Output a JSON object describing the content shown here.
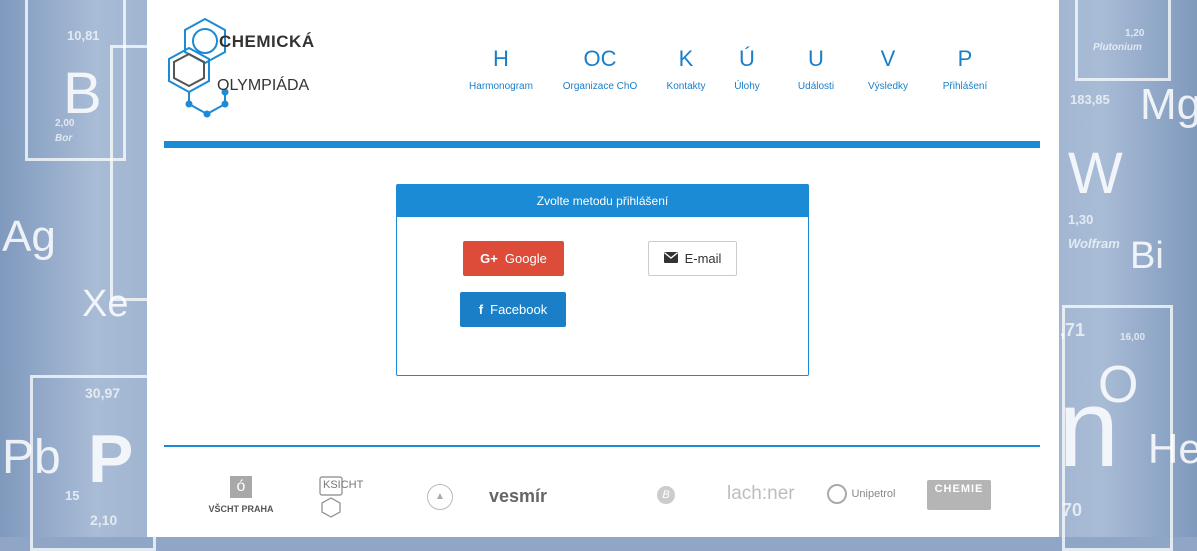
{
  "brand": {
    "line1": "CHEMICKÁ",
    "line2": "OLYMPIÁDA"
  },
  "nav": [
    {
      "letter": "H",
      "label": "Harmonogram"
    },
    {
      "letter": "OC",
      "label": "Organizace ChO"
    },
    {
      "letter": "K",
      "label": "Kontakty"
    },
    {
      "letter": "Ú",
      "label": "Úlohy"
    },
    {
      "letter": "U",
      "label": "Události"
    },
    {
      "letter": "V",
      "label": "Výsledky"
    },
    {
      "letter": "P",
      "label": "Přihlášení"
    }
  ],
  "login": {
    "title": "Zvolte metodu přihlášení",
    "google": "Google",
    "email": "E-mail",
    "facebook": "Facebook"
  },
  "sponsors": {
    "vscht": "VŠCHT PRAHA",
    "ksicht": "KSICHT",
    "vesmir": "vesmír",
    "lachner": "lach:ner",
    "unipetrol": "Unipetrol",
    "chemie": "CHEMIE"
  },
  "background": {
    "left": [
      "10,81",
      "B",
      "2,00",
      "Bor",
      "Ag",
      "Xe",
      "30,97",
      "P",
      "Pb",
      "15",
      "2,10"
    ],
    "right": [
      "1,20",
      "Plutonium",
      "183,85",
      "Mg",
      "W",
      "1,30",
      "Wolfram",
      "Bi",
      ",71",
      "16,00",
      "O",
      "n",
      "He",
      "70"
    ]
  },
  "colors": {
    "accent": "#1a8bd4",
    "google": "#dd4b39",
    "facebook": "#1b7fc7"
  }
}
